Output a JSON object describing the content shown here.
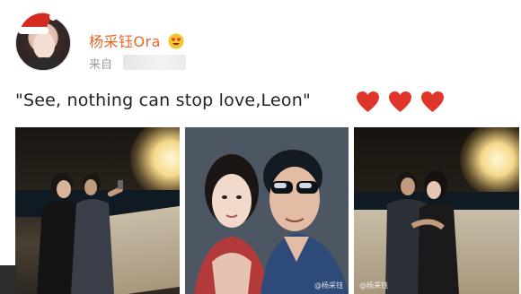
{
  "post": {
    "username": "杨采钰Ora",
    "source_prefix": "来自",
    "text": "\"See, nothing can stop love,Leon\"",
    "hearts": 3,
    "heart_color": "#e0352b",
    "username_color": "#e8682a",
    "photos": [
      {
        "watermark": ""
      },
      {
        "watermark": "@杨采钰"
      },
      {
        "watermark": "@杨采钰"
      }
    ]
  }
}
